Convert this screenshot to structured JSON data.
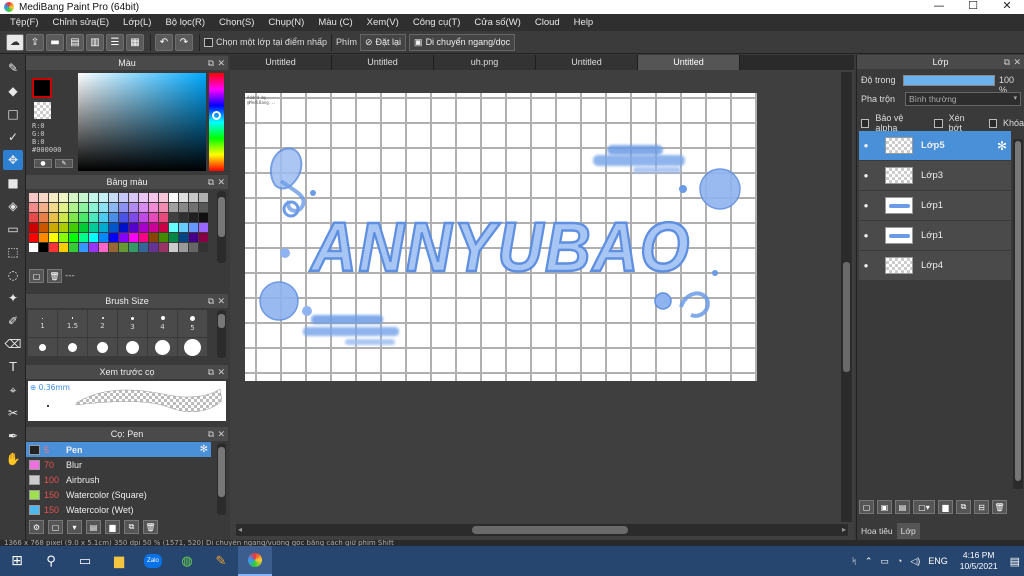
{
  "window": {
    "title": "MediBang Paint Pro (64bit)",
    "controls": {
      "minimize": "—",
      "maximize": "☐",
      "close": "✕"
    }
  },
  "menu": [
    "Tệp(F)",
    "Chỉnh sửa(E)",
    "Lớp(L)",
    "Bộ lọc(R)",
    "Chọn(S)",
    "Chụp(N)",
    "Màu (C)",
    "Xem(V)",
    "Công cụ(T)",
    "Cửa số(W)",
    "Cloud",
    "Help"
  ],
  "toolbar": {
    "select_one_layer_label": "Chọn một lớp tại điểm nhấp",
    "key_label": "Phím",
    "reset_label": "Đặt lại",
    "move_label": "Di chuyển ngang/dọc"
  },
  "color_panel": {
    "title": "Màu",
    "readout": [
      "R:0",
      "G:0",
      "B:0",
      "#000000"
    ],
    "fg_color": "#000000"
  },
  "palette_panel": {
    "title": "Bảng màu",
    "footer_text": "---",
    "colors": [
      "#f7c6c6",
      "#f7d8c6",
      "#f7ecc6",
      "#f0f7c6",
      "#d8f7c6",
      "#c6f7d0",
      "#c6f7ea",
      "#c6f0f7",
      "#c6dcf7",
      "#c6c8f7",
      "#d8c6f7",
      "#ecc6f7",
      "#f7c6ea",
      "#f7c6d8",
      "#ffffff",
      "#e0e0e0",
      "#c8c8c8",
      "#b0b0b0",
      "#f28b8b",
      "#f2b08b",
      "#f2d98b",
      "#e2f28b",
      "#b0f28b",
      "#8bf2a0",
      "#8bf2d6",
      "#8be2f2",
      "#8bb8f2",
      "#8b90f2",
      "#b08bf2",
      "#d98bf2",
      "#f28bd6",
      "#f28bb0",
      "#a0a0a0",
      "#888888",
      "#707070",
      "#585858",
      "#e84a4a",
      "#e87e4a",
      "#e8c04a",
      "#cce84a",
      "#7ee84a",
      "#4ae86a",
      "#4ae8bc",
      "#4accf2",
      "#4a8ee8",
      "#4a52e8",
      "#7e4ae8",
      "#c04ae8",
      "#e84abc",
      "#e84a7e",
      "#404040",
      "#303030",
      "#202020",
      "#101010",
      "#cc0000",
      "#cc5500",
      "#ccaa00",
      "#aacc00",
      "#44cc00",
      "#00cc33",
      "#00cc99",
      "#00aacc",
      "#0055cc",
      "#0011cc",
      "#5500cc",
      "#aa00cc",
      "#cc0099",
      "#cc0044",
      "#66ffff",
      "#66ccff",
      "#6699ff",
      "#9966ff",
      "#ff0000",
      "#ff8800",
      "#ffff00",
      "#88ff00",
      "#00ff00",
      "#00ff88",
      "#00ffff",
      "#0088ff",
      "#0000ff",
      "#8800ff",
      "#ff00ff",
      "#ff0088",
      "#884400",
      "#448800",
      "#008844",
      "#004488",
      "#440088",
      "#880044",
      "#ffffff",
      "#000000",
      "#ff3333",
      "#ffcc00",
      "#33cc33",
      "#3399ff",
      "#9933ff",
      "#ff66cc",
      "#996633",
      "#669933",
      "#339966",
      "#336699",
      "#663399",
      "#993366",
      "#cccccc",
      "#999999",
      "#666666",
      "#333333"
    ]
  },
  "brush_size_panel": {
    "title": "Brush Size",
    "sizes": [
      "1",
      "1.5",
      "2",
      "3",
      "4",
      "5",
      "",
      "",
      "",
      "",
      "",
      ""
    ]
  },
  "preview_panel": {
    "title": "Xem trước cọ",
    "size_label": "0.36mm"
  },
  "brush_panel": {
    "title": "Cọ: Pen",
    "brushes": [
      {
        "size": "5",
        "name": "Pen",
        "color": "#222222",
        "selected": true
      },
      {
        "size": "70",
        "name": "Blur",
        "color": "#f06fe0",
        "selected": false
      },
      {
        "size": "100",
        "name": "Airbrush",
        "color": "#cccccc",
        "selected": false
      },
      {
        "size": "150",
        "name": "Watercolor (Square)",
        "color": "#9fe04f",
        "selected": false
      },
      {
        "size": "150",
        "name": "Watercolor (Wet)",
        "color": "#4fb8f0",
        "selected": false
      }
    ]
  },
  "doc_tabs": [
    "Untitled",
    "Untitled",
    "uh.png",
    "Untitled",
    "Untitled"
  ],
  "canvas": {
    "artwork_text": "ANNYUBAO",
    "note_lines": [
      "Added by",
      "@MediBang..."
    ]
  },
  "layers_panel": {
    "title": "Lớp",
    "opacity_label": "Độ trong",
    "opacity_value": "100 %",
    "opacity_fraction": 1.0,
    "blend_label": "Pha trộn",
    "blend_value": "Bình thường",
    "protect_alpha": "Bảo vệ alpha",
    "clipping": "Xén bớt",
    "lock": "Khóa",
    "layers": [
      {
        "name": "Lớp5",
        "selected": true,
        "thumb": "empty"
      },
      {
        "name": "Lớp3",
        "selected": false,
        "thumb": "empty"
      },
      {
        "name": "Lớp1",
        "selected": false,
        "thumb": "art"
      },
      {
        "name": "Lớp1",
        "selected": false,
        "thumb": "art"
      },
      {
        "name": "Lớp4",
        "selected": false,
        "thumb": "empty"
      }
    ],
    "bottom_tabs": [
      "Hoa tiêu",
      "Lớp"
    ]
  },
  "status_bar": "1366 x 768 pixel  (9.0 x 5.1cm)  350 dpi  50 %  (1571, 520)  Di chuyển ngang/vuông góc bằng cách giữ phím Shift",
  "taskbar": {
    "language": "ENG",
    "time": "4:16 PM",
    "date": "10/5/2021",
    "zalo_label": "Zalo"
  },
  "colors": {
    "accent": "#4a90d9",
    "taskbar": "#27466f",
    "artwork_blue": "#6b9be6"
  }
}
